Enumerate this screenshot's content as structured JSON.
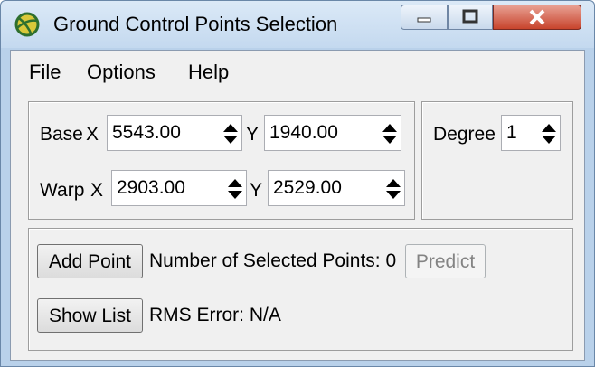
{
  "window": {
    "title": "Ground Control Points Selection"
  },
  "menu": {
    "items": [
      "File",
      "Options",
      "Help"
    ]
  },
  "coords": {
    "base_label": "Base",
    "warp_label": "Warp",
    "x_label": "X",
    "y_label": "Y",
    "base_x": "5543.00",
    "base_y": "1940.00",
    "warp_x": "2903.00",
    "warp_y": "2529.00"
  },
  "degree": {
    "label": "Degree",
    "value": "1"
  },
  "actions": {
    "add_point": "Add Point",
    "selected_points": "Number of Selected Points: 0",
    "predict": "Predict",
    "show_list": "Show List",
    "rms_error": "RMS Error: N/A"
  },
  "icons": [
    "globe-icon",
    "minimize-icon",
    "maximize-icon",
    "close-icon",
    "spin-arrows-icon"
  ]
}
